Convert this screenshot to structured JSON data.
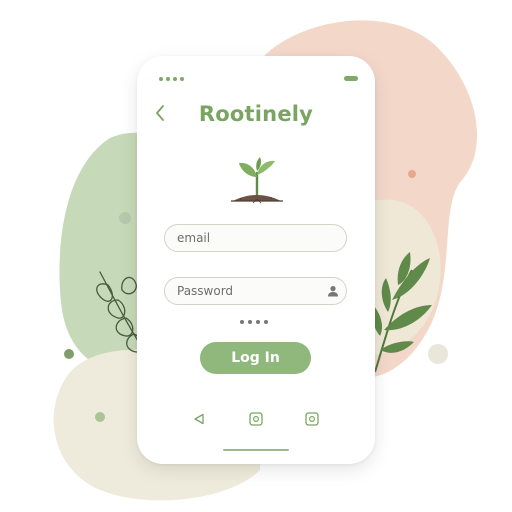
{
  "app": {
    "title": "Rootinely"
  },
  "login_form": {
    "email_placeholder": "email",
    "password_placeholder": "Password",
    "submit_label": "Log In"
  },
  "icons": {
    "back": "chevron-left-icon",
    "logo": "sprout-icon",
    "password_user": "user-icon",
    "nav_back": "triangle-back-icon",
    "nav_home": "square-home-icon",
    "nav_recent": "square-recent-icon"
  },
  "colors": {
    "accent": "#7aa461",
    "button": "#90b87c",
    "blob_green": "#c4d8b6",
    "blob_peach": "#f2d6c7",
    "blob_cream": "#efeadb"
  }
}
